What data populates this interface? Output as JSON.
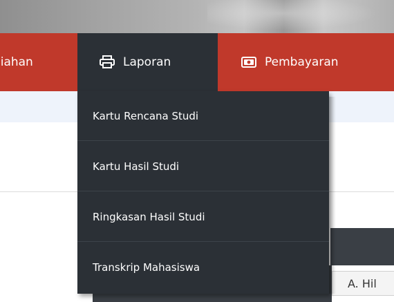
{
  "navbar": {
    "items": [
      {
        "label": "liahan",
        "icon": ""
      },
      {
        "label": "Laporan",
        "icon": "printer-icon"
      },
      {
        "label": "Pembayaran",
        "icon": "money-icon"
      }
    ],
    "colors": {
      "primary": "#c0392b",
      "active": "#2b3036"
    }
  },
  "dropdown": {
    "items": [
      {
        "label": "Kartu Rencana Studi"
      },
      {
        "label": "Kartu Hasil Studi"
      },
      {
        "label": "Ringkasan Hasil Studi"
      },
      {
        "label": "Transkrip Mahasiswa"
      }
    ]
  },
  "table": {
    "cell_text": "A. Hil"
  }
}
